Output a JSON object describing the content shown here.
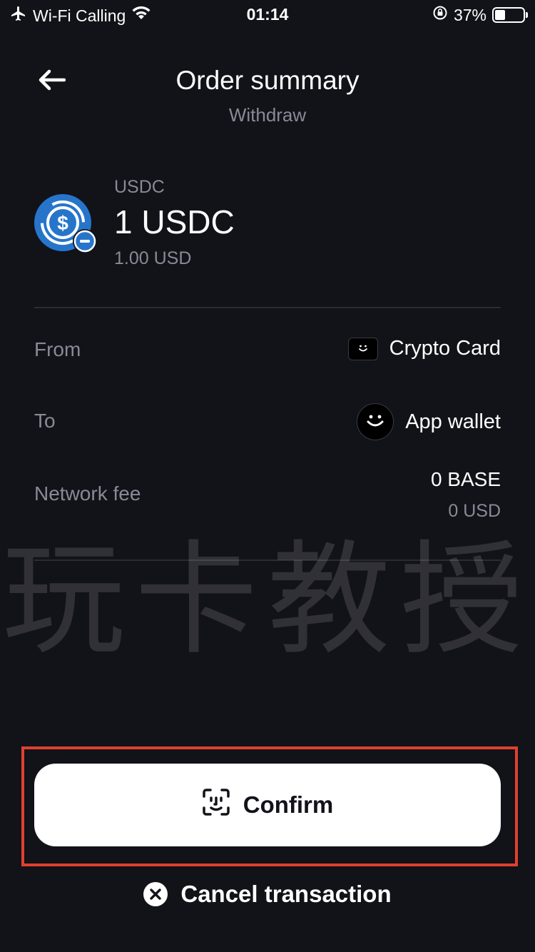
{
  "status_bar": {
    "carrier": "Wi-Fi Calling",
    "time": "01:14",
    "battery": "37%",
    "battery_level": 0.37,
    "icons": [
      "airplane-icon",
      "wifi-icon",
      "orientation-lock-icon",
      "battery-icon"
    ]
  },
  "header": {
    "title": "Order summary",
    "subtitle": "Withdraw",
    "back_icon": "arrow-left-icon"
  },
  "asset": {
    "label": "USDC",
    "amount": "1 USDC",
    "value": "1.00 USD",
    "icon": "usdc-icon",
    "badge_icon": "minus-badge-icon"
  },
  "details": {
    "from": {
      "label": "From",
      "value": "Crypto Card",
      "icon": "card-icon"
    },
    "to": {
      "label": "To",
      "value": "App wallet",
      "icon": "wallet-icon"
    },
    "fee": {
      "label": "Network fee",
      "value": "0 BASE",
      "sub_value": "0 USD"
    }
  },
  "watermark": "玩卡教授",
  "actions": {
    "confirm_label": "Confirm",
    "confirm_icon": "face-id-icon",
    "cancel_label": "Cancel transaction",
    "cancel_icon": "close-circle-icon"
  },
  "colors": {
    "background": "#121219",
    "muted_text": "#8a8a96",
    "usdc_blue": "#2775ca",
    "highlight": "#e0402f",
    "button_bg": "#ffffff"
  }
}
